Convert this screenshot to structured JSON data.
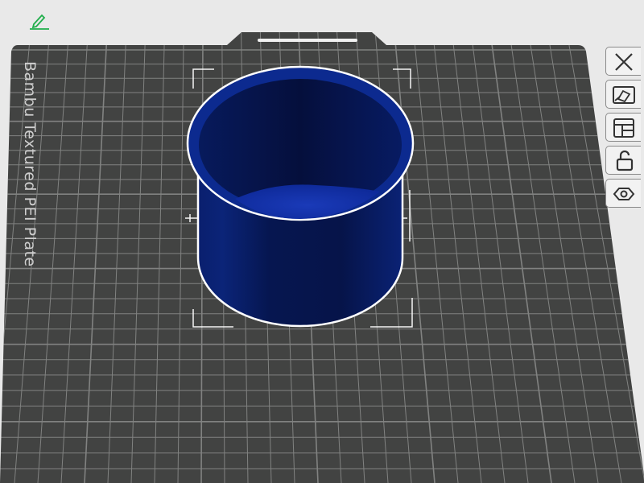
{
  "plate": {
    "label": "Bambu Textured PEI Plate",
    "surface_color": "#424342",
    "grid_color": "#8c8e8c"
  },
  "model": {
    "color": "#0c2a8f",
    "outline_color": "#ffffff"
  },
  "toolbar": {
    "items": [
      {
        "name": "close-plate-icon"
      },
      {
        "name": "auto-orient-icon"
      },
      {
        "name": "arrange-icon"
      },
      {
        "name": "lock-icon"
      },
      {
        "name": "settings-icon"
      }
    ]
  },
  "edit_icon": {
    "color": "#1fae4a"
  }
}
